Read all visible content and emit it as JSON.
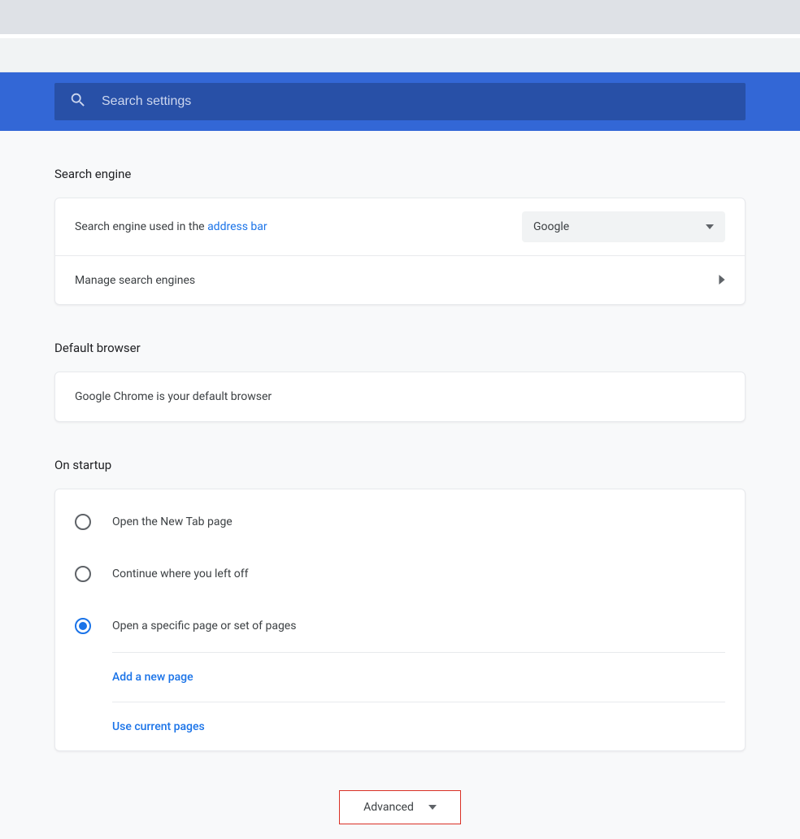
{
  "search": {
    "placeholder": "Search settings"
  },
  "sections": {
    "search_engine": {
      "title": "Search engine",
      "row_prefix": "Search engine used in the ",
      "row_link": "address bar",
      "selected_engine": "Google",
      "manage_label": "Manage search engines"
    },
    "default_browser": {
      "title": "Default browser",
      "status": "Google Chrome is your default browser"
    },
    "on_startup": {
      "title": "On startup",
      "options": [
        {
          "label": "Open the New Tab page",
          "selected": false
        },
        {
          "label": "Continue where you left off",
          "selected": false
        },
        {
          "label": "Open a specific page or set of pages",
          "selected": true
        }
      ],
      "add_page": "Add a new page",
      "use_current": "Use current pages"
    }
  },
  "advanced_label": "Advanced"
}
